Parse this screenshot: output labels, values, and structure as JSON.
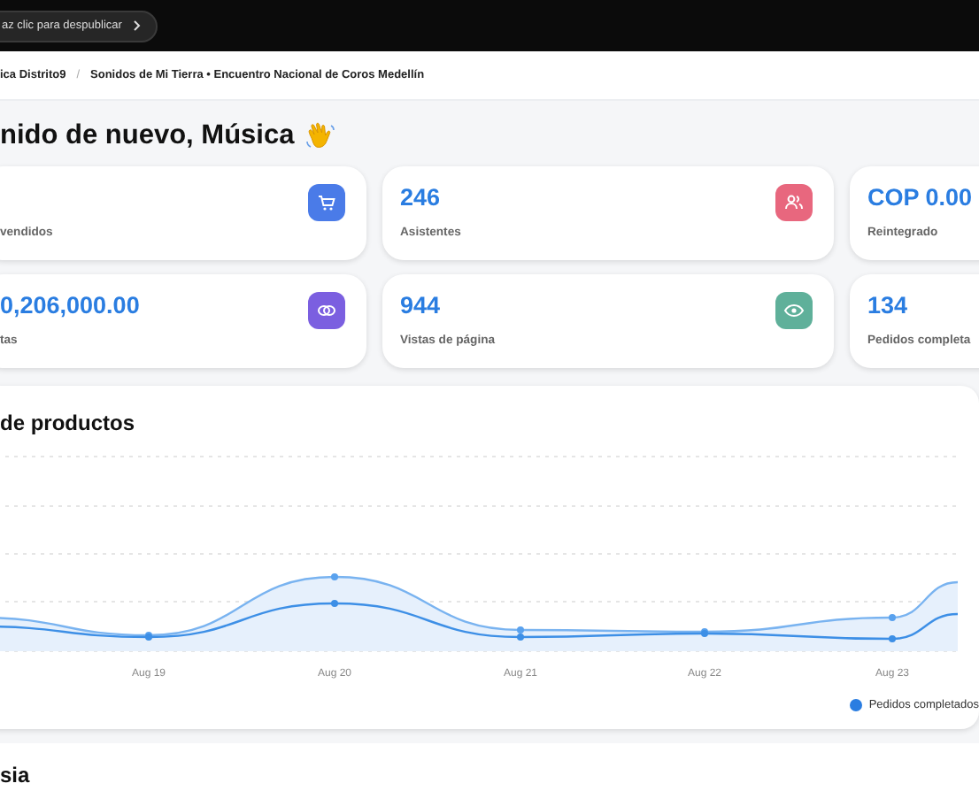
{
  "publish_bar": {
    "text": "az clic para despublicar"
  },
  "breadcrumb": {
    "separator": "/",
    "items": [
      {
        "label": "ica Distrito9"
      },
      {
        "label": "Sonidos de Mi Tierra • Encuentro Nacional de Coros Medellín"
      }
    ]
  },
  "greeting": "nido de nuevo, Música",
  "stats": [
    {
      "label": "vendidos",
      "kind": "cart",
      "color": "#4a7be8"
    },
    {
      "value": "246",
      "label": "Asistentes",
      "kind": "users",
      "color": "#e8677e"
    },
    {
      "value": "COP 0.00",
      "label": "Reintegrado"
    },
    {
      "value": "0,206,000.00",
      "label": "tas",
      "kind": "coins",
      "color": "#7b5fe0"
    },
    {
      "value": "944",
      "label": "Vistas de página",
      "kind": "eye",
      "color": "#5fb09a"
    },
    {
      "value": "134",
      "label": "Pedidos completa"
    }
  ],
  "sales_chart": {
    "title": "de productos",
    "x_labels": [
      "Aug 19",
      "Aug 20",
      "Aug 21",
      "Aug 22",
      "Aug 23"
    ],
    "legend": "Pedidos completados"
  },
  "next_section": {
    "title": "sia"
  }
}
